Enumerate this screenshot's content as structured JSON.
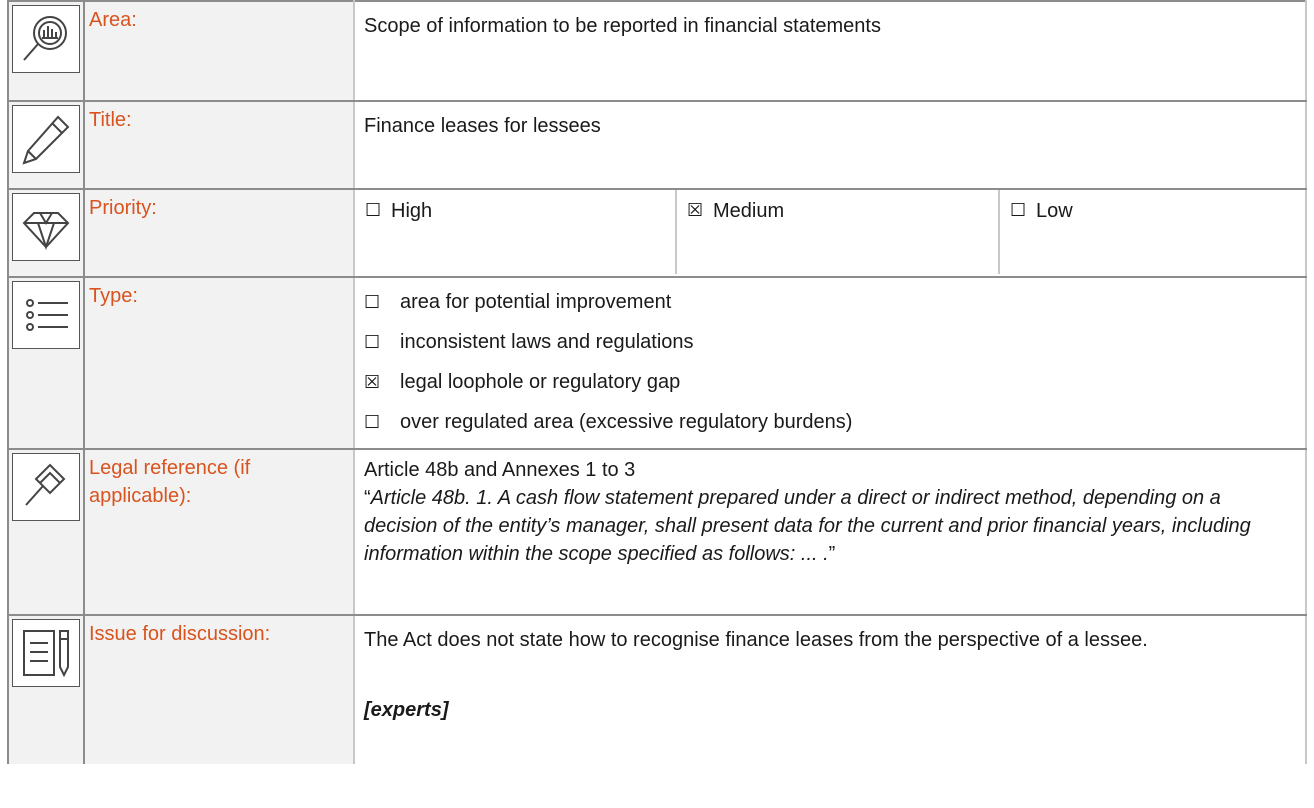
{
  "rows": {
    "area": {
      "label": "Area:",
      "value": "Scope of information to be reported in financial statements",
      "icon": "magnifier-chart-icon"
    },
    "title": {
      "label": "Title:",
      "value": "Finance leases for lessees",
      "icon": "pencil-icon"
    },
    "priority": {
      "label": "Priority:",
      "icon": "diamond-icon",
      "options": [
        {
          "mark": "☐",
          "text": "High"
        },
        {
          "mark": "☒",
          "text": "Medium"
        },
        {
          "mark": "☐",
          "text": "Low"
        }
      ]
    },
    "type": {
      "label": "Type:",
      "icon": "list-icon",
      "options": [
        {
          "mark": "☐",
          "text": "area for potential improvement"
        },
        {
          "mark": "☐",
          "text": "inconsistent laws and regulations"
        },
        {
          "mark": "☒",
          "text": "legal loophole or regulatory gap"
        },
        {
          "mark": "☐",
          "text": "over regulated area (excessive regulatory burdens)"
        }
      ]
    },
    "legal": {
      "label": "Legal reference (if applicable):",
      "icon": "gavel-icon",
      "reference": "Article 48b and Annexes 1 to 3",
      "quote_open": "“",
      "quote_text": "Article 48b. 1. A cash flow statement prepared under a direct or indirect method, depending on a decision of the entity’s manager, shall present data for the current and prior financial years, including information within the scope specified as follows: ... .",
      "quote_close": "”"
    },
    "issue": {
      "label": "Issue for discussion:",
      "icon": "document-pen-icon",
      "text": "The Act does not state how to recognise finance leases from the perspective of a lessee.",
      "note": "[experts]"
    }
  }
}
